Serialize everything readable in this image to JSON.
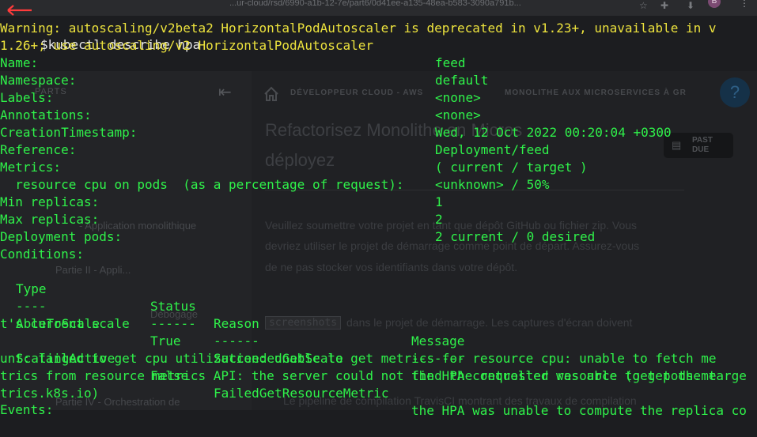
{
  "background_browser": {
    "url": "...ur-cloud/rsd/6990-a1b-12-7e/part6/0d41ee-a135-48ea-b583-3090a791b...",
    "avatar_letter": "B",
    "sidebar": {
      "heading": "PARTS",
      "items": [
        "- Application monolithique",
        "Partie II - Appli...",
        "Débogage",
        "Partie IV - Orchestration de"
      ]
    },
    "breadcrumb": [
      "DÉVELOPPEUR CLOUD - AWS",
      "MONOLITHE AUX MICROSERVICES À GR"
    ],
    "title_line1": "Refactorisez Monolithe en Micros",
    "title_line2": "déployez",
    "status_badge": "PAST DUE",
    "para_line1": "Veuillez soumettre votre projet en tant que dépôt GitHub ou fichier zip. Vous",
    "para_line2": "devriez utiliser le projet de démarrage comme point de départ. Assurez-vous",
    "para_line3": "de ne pas stocker vos identifiants dans votre dépôt.",
    "code_snippet": "screenshots",
    "para_line4": "dans le projet de démarrage. Les captures d'écran doivent",
    "bullet": "Le pipeline de compilation TravisCI montrant des travaux de compilation"
  },
  "terminal": {
    "command": "$kubectl describe hpa",
    "warning_line1": "Warning: autoscaling/v2beta2 HorizontalPodAutoscaler is deprecated in v1.23+, unavailable in v",
    "warning_line2": "1.26+; use autoscaling/v2 HorizontalPodAutoscaler",
    "fields": [
      {
        "key": "Name:",
        "value": "feed"
      },
      {
        "key": "Namespace:",
        "value": "default"
      },
      {
        "key": "Labels:",
        "value": "<none>"
      },
      {
        "key": "Annotations:",
        "value": "<none>"
      },
      {
        "key": "CreationTimestamp:",
        "value": "Wed, 12 Oct 2022 00:20:04 +0300"
      },
      {
        "key": "Reference:",
        "value": "Deployment/feed"
      },
      {
        "key": "Metrics:",
        "value": "( current / target )"
      },
      {
        "key": "  resource cpu on pods  (as a percentage of request):",
        "value": "<unknown> / 50%"
      },
      {
        "key": "Min replicas:",
        "value": "1"
      },
      {
        "key": "Max replicas:",
        "value": "2"
      },
      {
        "key": "Deployment pods:",
        "value": "2 current / 0 desired"
      }
    ],
    "conditions_label": "Conditions:",
    "conditions_header": {
      "type": "Type",
      "status": "Status",
      "reason": "Reason",
      "message": "Message"
    },
    "conditions_sep": {
      "type": "----",
      "status": "------",
      "reason": "------",
      "message": "-------"
    },
    "cond1": {
      "type": "AbleToScale",
      "status": "True",
      "reason": "SucceededGetScale",
      "message": "the HPA controller was able to get the targe",
      "wrap1": "t's current scale"
    },
    "cond2": {
      "type": "ScalingActive",
      "status": "False",
      "reason": "FailedGetResourceMetric",
      "message": "the HPA was unable to compute the replica co",
      "wrap1": "unt: failed to get cpu utilization: unable to get metrics for resource cpu: unable to fetch me",
      "wrap2": "trics from resource metrics API: the server could not find the requested resource (get pods.me",
      "wrap3": "trics.k8s.io)"
    },
    "events_label": "Events:"
  }
}
